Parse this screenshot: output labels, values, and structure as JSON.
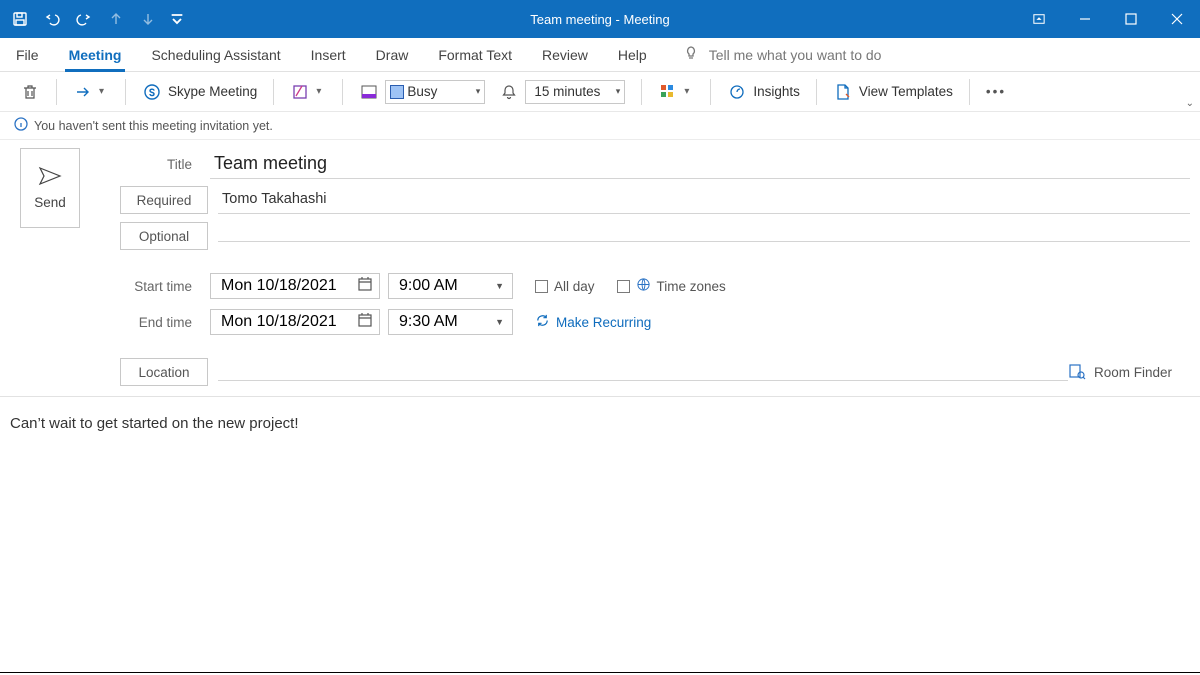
{
  "window": {
    "title_doc": "Team meeting",
    "title_sep": "  -  ",
    "title_type": "Meeting"
  },
  "tabs": {
    "file": "File",
    "meeting": "Meeting",
    "scheduling": "Scheduling Assistant",
    "insert": "Insert",
    "draw": "Draw",
    "format": "Format Text",
    "review": "Review",
    "help": "Help",
    "tellme_placeholder": "Tell me what you want to do"
  },
  "ribbon": {
    "skype": "Skype Meeting",
    "busy": "Busy",
    "reminder": "15 minutes",
    "insights": "Insights",
    "templates": "View Templates"
  },
  "infobar": {
    "text": "You haven't sent this meeting invitation yet."
  },
  "form": {
    "send": "Send",
    "title_label": "Title",
    "title_value": "Team meeting",
    "required_label": "Required",
    "required_value": "Tomo Takahashi",
    "optional_label": "Optional",
    "optional_value": "",
    "start_label": "Start time",
    "end_label": "End time",
    "start_date": "Mon 10/18/2021",
    "start_time": "9:00 AM",
    "end_date": "Mon 10/18/2021",
    "end_time": "9:30 AM",
    "allday": "All day",
    "timezones": "Time zones",
    "recurring": "Make Recurring",
    "location_label": "Location",
    "location_value": "",
    "room_finder": "Room Finder"
  },
  "body": {
    "text": "Can’t wait to get started on the new project!"
  }
}
